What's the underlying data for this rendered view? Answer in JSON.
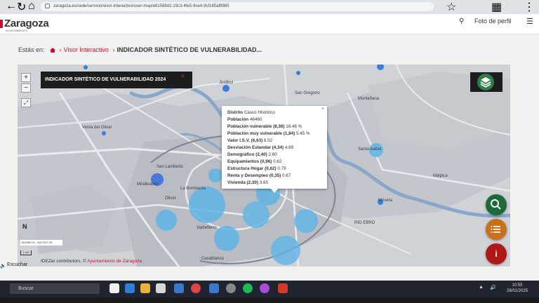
{
  "browser": {
    "url": "zaragoza.es/sede/servicio/visor-interactivo/user-map/e81569d2-19c3-4fe5-9ce4-9cf185af8985"
  },
  "header": {
    "logo": "Zaragoza",
    "logo_sub": "AYUNTAMIENTO",
    "profile": "Foto de perfil"
  },
  "breadcrumb": {
    "label": "Estás en:",
    "link": "Visor Interactivo",
    "current": "INDICADOR SINTÉTICO DE VULNERABILIDAD..."
  },
  "map": {
    "title": "INDICADOR SINTÉTICO DE VULNERABILIDAD 2024",
    "zoom_in": "+",
    "zoom_out": "−",
    "coords": "664282.01 ; 4617327.25",
    "scale": "1 km",
    "north": "N",
    "attribution_prefix": "IDEZar contributors, ©",
    "attribution_link": "Ayuntamiento de Zaragoza",
    "places": [
      "Juslibol",
      "San Gregorio",
      "Montañana",
      "Venta del Olivar",
      "Santa Isabel",
      "San Lamberto",
      "Miralbueno",
      "La Bombarda",
      "Oliver",
      "Valdefierro",
      "Casablanca",
      "Movera",
      "Malpica",
      "RIO EBRO"
    ]
  },
  "popup": {
    "rows": [
      {
        "label": "Distrito",
        "value": "Casco Histórico"
      },
      {
        "label": "Población",
        "value": "46460"
      },
      {
        "label": "Población vulnerable (8,36)",
        "value": "16.46 %"
      },
      {
        "label": "Población muy vulnerable (1,84)",
        "value": "5.45 %"
      },
      {
        "label": "Valor I.S.V. (6,63)",
        "value": "8.52"
      },
      {
        "label": "Desviación Estandar (4,34)",
        "value": "4.89"
      },
      {
        "label": "Demográfico (2,40)",
        "value": "2.80"
      },
      {
        "label": "Equipamientos (0,96)",
        "value": "0.62"
      },
      {
        "label": "Estructura Hogar (0,62)",
        "value": "0.79"
      },
      {
        "label": "Renta y Desempleo (0,35)",
        "value": "0.67"
      },
      {
        "label": "Vivienda (2,30)",
        "value": "3.65"
      }
    ]
  },
  "page": {
    "listen": "Escuchar"
  },
  "taskbar": {
    "search": "Buscar",
    "time": "10:55",
    "date": "28/01/2025"
  },
  "colors": {
    "brand": "#c8102e",
    "bubble": "#5fb4e6",
    "search_fab": "#1b6b3a",
    "list_fab": "#c7711a",
    "info_fab": "#b01818"
  }
}
